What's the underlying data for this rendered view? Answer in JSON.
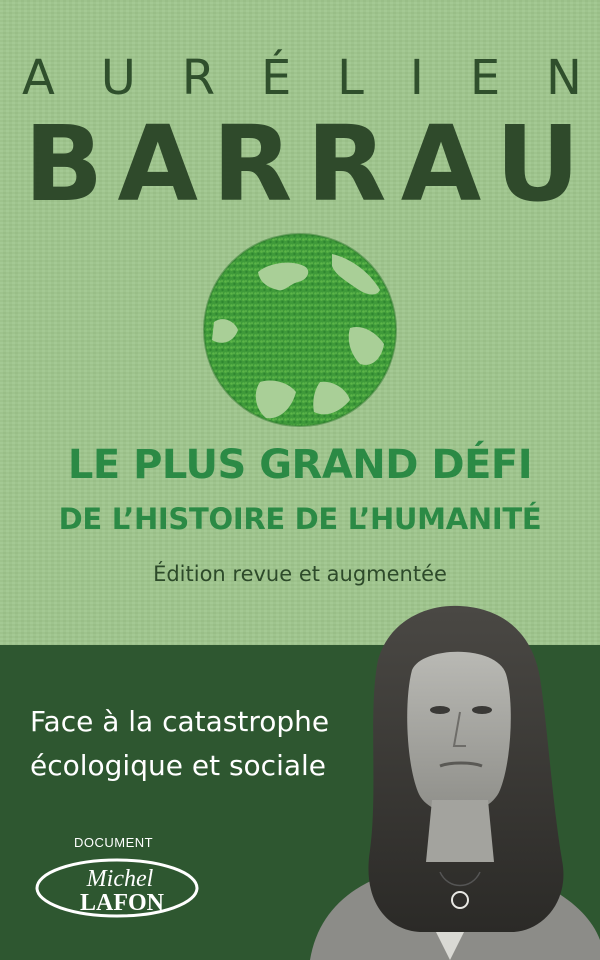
{
  "author": {
    "first_letters": [
      "A",
      "U",
      "R",
      "É",
      "L",
      "I",
      "E",
      "N"
    ],
    "last_letters": [
      "B",
      "A",
      "R",
      "R",
      "A",
      "U"
    ]
  },
  "title": {
    "line1": "LE PLUS GRAND DÉFI",
    "line2": "DE L’HISTOIRE DE L’HUMANITÉ"
  },
  "edition": "Édition revue et augmentée",
  "tagline": {
    "line1": "Face à la catastrophe",
    "line2": "écologique et sociale"
  },
  "publisher": {
    "label": "DOCUMENT",
    "name_top": "Michel",
    "name_bottom": "LAFON"
  },
  "colors": {
    "background": "#9ec58c",
    "author": "#2f4a2b",
    "title": "#2b8a45",
    "band": "#2e5730"
  },
  "icons": {
    "globe": "moss-globe-icon",
    "portrait": "author-portrait"
  }
}
